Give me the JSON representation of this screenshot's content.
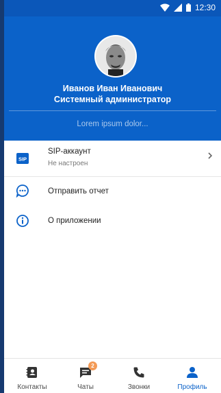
{
  "status_bar": {
    "time": "12:30"
  },
  "profile": {
    "name": "Иванов Иван Иванович",
    "role": "Системный администратор",
    "bio_placeholder": "Lorem ipsum dolor..."
  },
  "menu": [
    {
      "title": "SIP-аккаунт",
      "subtitle": "Не настроен",
      "icon": "sip-icon",
      "icon_text": "SIP"
    },
    {
      "title": "Отправить отчет",
      "icon": "report-icon"
    },
    {
      "title": "О приложении",
      "icon": "info-icon"
    }
  ],
  "bottom_nav": [
    {
      "label": "Контакты",
      "icon": "contacts-icon"
    },
    {
      "label": "Чаты",
      "icon": "chats-icon",
      "badge": "2"
    },
    {
      "label": "Звонки",
      "icon": "phone-icon"
    },
    {
      "label": "Профиль",
      "icon": "profile-icon",
      "active": true
    }
  ],
  "colors": {
    "primary": "#0b62c9",
    "status_bar": "#0b57b9",
    "badge": "#f39a56"
  }
}
